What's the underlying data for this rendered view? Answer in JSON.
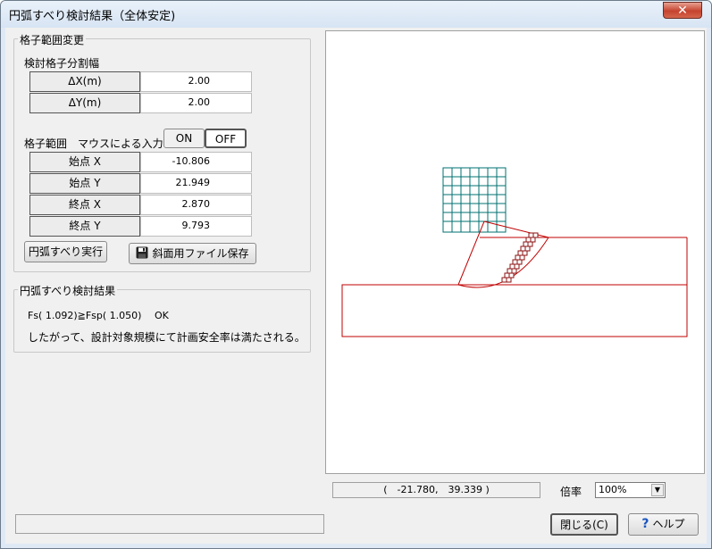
{
  "window": {
    "title": "円弧すべり検討結果（全体安定)",
    "close_label": "✕"
  },
  "grid_group": {
    "legend": "格子範囲変更",
    "subtitle": "検討格子分割幅",
    "rows": [
      {
        "label": "ΔX(m)",
        "value": "2.00"
      },
      {
        "label": "ΔY(m)",
        "value": "2.00"
      }
    ],
    "mouse_label": "格子範囲　マウスによる入力",
    "on_label": "ON",
    "off_label": "OFF",
    "points": [
      {
        "label": "始点 X",
        "value": "-10.806"
      },
      {
        "label": "始点 Y",
        "value": "21.949"
      },
      {
        "label": "終点 X",
        "value": "2.870"
      },
      {
        "label": "終点 Y",
        "value": "9.793"
      }
    ],
    "run_label": "円弧すべり実行",
    "save_label": "斜面用ファイル保存",
    "save_icon": "floppy-disk-icon"
  },
  "result_group": {
    "legend": "円弧すべり検討結果",
    "line1": "Fs( 1.092)≧Fsp( 1.050)　 OK",
    "line2": "したがって、設計対象規模にて計画安全率は満たされる。"
  },
  "canvas": {
    "coords": "(　-21.780,　39.339 )",
    "zoom_label": "倍率",
    "zoom_value": "100%"
  },
  "buttons": {
    "close_label": "閉じる(C)",
    "help_label": "ヘルプ",
    "help_icon": "question-icon"
  },
  "colors": {
    "grid": "#007070",
    "slope": "#c00000",
    "arc": "#b01010",
    "blocks": "#8b1010"
  }
}
